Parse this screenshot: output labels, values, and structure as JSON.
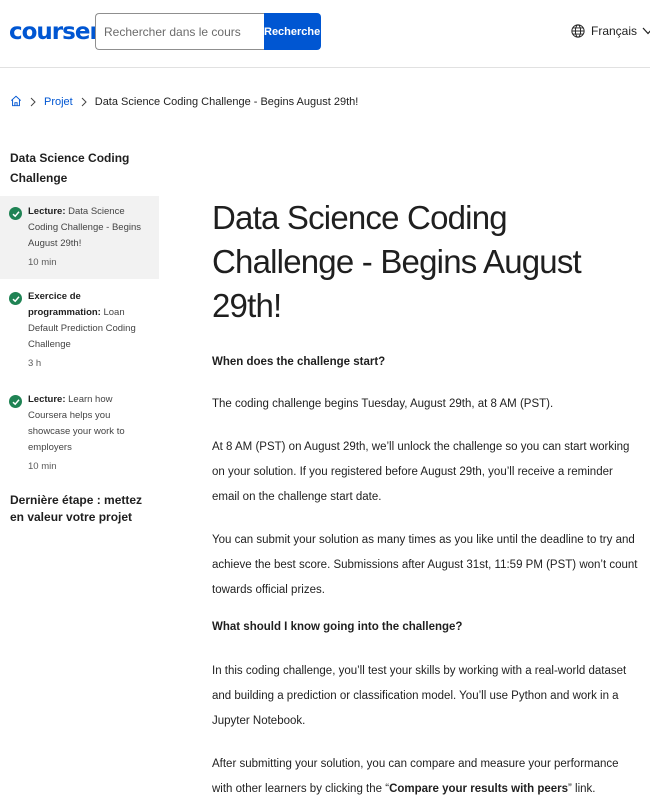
{
  "header": {
    "logo_text": "coursera",
    "search_placeholder": "Rechercher dans le cours",
    "search_button": "Rechercher",
    "language": "Français"
  },
  "breadcrumb": {
    "items": [
      "Projet",
      "Data Science Coding Challenge - Begins August 29th!"
    ]
  },
  "sidebar": {
    "module_title": "Data Science Coding Challenge",
    "items": [
      {
        "type": "Lecture:",
        "text": "Data Science Coding Challenge - Begins August 29th!",
        "duration": "10 min",
        "active": true
      },
      {
        "type": "Exercice de programmation:",
        "text": "Loan Default Prediction Coding Challenge",
        "duration": "3 h",
        "active": false
      },
      {
        "type": "Lecture:",
        "text": "Learn how Coursera helps you showcase your work to employers",
        "duration": "10 min",
        "active": false
      }
    ],
    "last_step": "Dernière étape : mettez en valeur votre projet"
  },
  "main": {
    "title": "Data Science Coding Challenge - Begins August 29th!",
    "heading1": "When does the challenge start?",
    "p1": "The coding challenge begins Tuesday, August 29th, at 8 AM (PST).",
    "p2": "At 8 AM (PST) on August 29th, we’ll unlock the challenge so you can start working on your solution. If you registered before August 29th, you’ll receive a reminder email on the challenge start date.",
    "p3": "You can submit your solution as many times as you like until the deadline to try and achieve the best score. Submissions after August 31st, 11:59 PM (PST) won’t count towards official prizes.",
    "heading2": "What should I know going into the challenge?",
    "p4": "In this coding challenge, you’ll test your skills by working with a real-world dataset and building a prediction or classification model. You’ll use Python and work in a Jupyter Notebook.",
    "p5_before": "After submitting your solution, you can compare and measure your performance with other learners by clicking the “",
    "p5_bold": "Compare your results with peers",
    "p5_after": "” link."
  },
  "colors": {
    "brand": "#0056d2",
    "success": "#1f8354"
  }
}
